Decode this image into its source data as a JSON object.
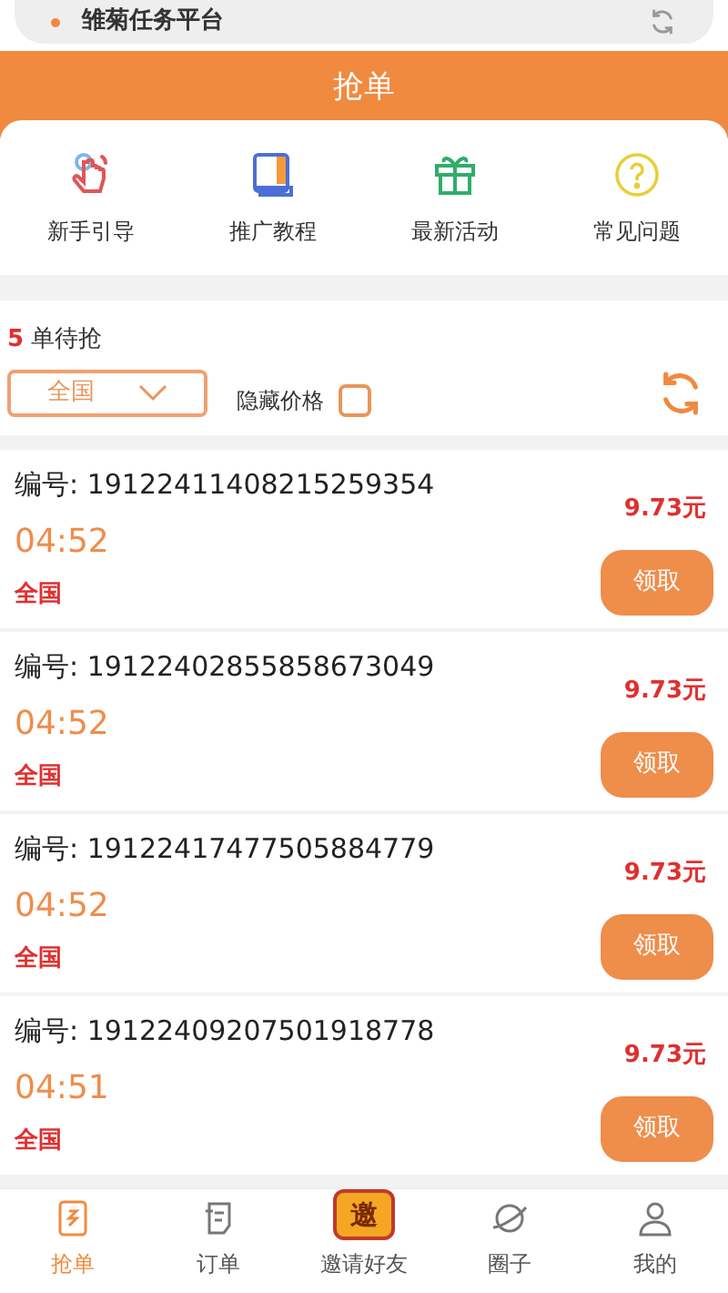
{
  "top_bar": {
    "title": "雏菊任务平台"
  },
  "header": {
    "title": "抢单"
  },
  "shortcuts": [
    {
      "kind": "hand",
      "label": "新手引导"
    },
    {
      "kind": "book",
      "label": "推广教程"
    },
    {
      "kind": "gift",
      "label": "最新活动"
    },
    {
      "kind": "question",
      "label": "常见问题"
    }
  ],
  "filter": {
    "count": "5",
    "count_label": "单待抢",
    "region": "全国",
    "hide_price_label": "隐藏价格",
    "hide_price_checked": false
  },
  "orders": [
    {
      "number": "编号: 19122411408215259354",
      "time": "04:52",
      "region": "全国",
      "price": "9.73元",
      "button": "领取"
    },
    {
      "number": "编号: 19122402855858673049",
      "time": "04:52",
      "region": "全国",
      "price": "9.73元",
      "button": "领取"
    },
    {
      "number": "编号: 19122417477505884779",
      "time": "04:52",
      "region": "全国",
      "price": "9.73元",
      "button": "领取"
    },
    {
      "number": "编号: 19122409207501918778",
      "time": "04:51",
      "region": "全国",
      "price": "9.73元",
      "button": "领取"
    }
  ],
  "tab_bar": [
    {
      "kind": "grab",
      "label": "抢单",
      "selected": true
    },
    {
      "kind": "orders",
      "label": "订单",
      "selected": false
    },
    {
      "kind": "invite",
      "label": "邀请好友",
      "badge": "邀",
      "selected": false
    },
    {
      "kind": "circle",
      "label": "圈子",
      "selected": false
    },
    {
      "kind": "me",
      "label": "我的",
      "selected": false
    }
  ]
}
